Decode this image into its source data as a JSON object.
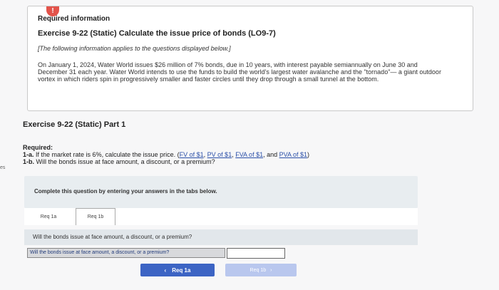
{
  "left_margin_text": "es",
  "info": {
    "badge": "!",
    "heading": "Required information",
    "title": "Exercise 9-22 (Static) Calculate the issue price of bonds (LO9-7)",
    "note": "[The following information applies to the questions displayed below.]",
    "body": "On January 1, 2024, Water World issues $26 million of 7% bonds, due in 10 years, with interest payable semiannually on June 30 and December 31 each year. Water World intends to use the funds to build the world's largest water avalanche and the \"tornado\"— a giant outdoor vortex in which riders spin in progressively smaller and faster circles until they drop through a small tunnel at the bottom."
  },
  "part": {
    "title": "Exercise 9-22 (Static) Part 1"
  },
  "required": {
    "label": "Required:",
    "item_1a_prefix": "1-a.",
    "item_1a_text": "If the market rate is 6%, calculate the issue price.",
    "links": [
      "FV of $1",
      "PV of $1",
      "FVA of $1",
      "PVA of $1"
    ],
    "item_1b_prefix": "1-b.",
    "item_1b_text": "Will the bonds issue at face amount, a discount, or a premium?"
  },
  "panel": {
    "instruction": "Complete this question by entering your answers in the tabs below."
  },
  "tabs": [
    {
      "label": "Req 1a"
    },
    {
      "label": "Req 1b"
    }
  ],
  "question": {
    "text": "Will the bonds issue at face amount, a discount, or a premium?",
    "answer_label": "Will the bonds issue at face amount, a discount, or a premium?",
    "answer_value": ""
  },
  "nav": {
    "prev_icon": "‹",
    "prev_label": "Req 1a",
    "next_label": "Req 1b",
    "next_icon": "›"
  }
}
